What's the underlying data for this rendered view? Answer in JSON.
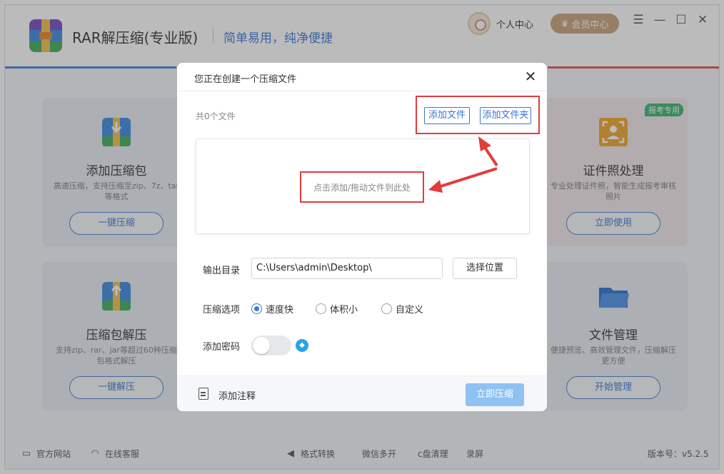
{
  "app": {
    "title": "RAR解压缩(专业版)",
    "slogan": "简单易用，纯净便捷",
    "personal_center": "个人中心",
    "vip_center": "会员中心"
  },
  "cards": [
    {
      "title": "添加压缩包",
      "desc": "高速压缩，支持压缩至zip、7z、tar等格式",
      "button": "一键压缩"
    },
    {
      "title": "证件照处理",
      "desc": "专业处理证件照，智能生成报考审核照片",
      "button": "立即使用",
      "badge": "报考专用"
    },
    {
      "title": "压缩包解压",
      "desc": "支持zip、rar、jar等超过60种压缩包格式解压",
      "button": "一键解压"
    },
    {
      "title": "文件管理",
      "desc": "便捷预览、高效管理文件，压缩解压更方便",
      "button": "开始管理"
    }
  ],
  "footer": {
    "website": "官方网站",
    "service": "在线客服",
    "format": "格式转换",
    "wechat": "微信多开",
    "cclean": "c盘清理",
    "record": "录屏",
    "version": "版本号：v5.2.5"
  },
  "dialog": {
    "title": "您正在创建一个压缩文件",
    "file_count": "共0个文件",
    "add_file": "添加文件",
    "add_folder": "添加文件夹",
    "drop_hint": "点击添加/拖动文件到此处",
    "output_label": "输出目录",
    "output_path": "C:\\Users\\admin\\Desktop\\",
    "choose_location": "选择位置",
    "options_label": "压缩选项",
    "options": [
      "速度快",
      "体积小",
      "自定义"
    ],
    "selected_option": "速度快",
    "password_label": "添加密码",
    "password_enabled": false,
    "add_note": "添加注释",
    "compress_now": "立即压缩"
  },
  "colors": {
    "accent": "#3a78d6",
    "annotation_red": "#e23c3c",
    "compress_button": "#8fc2f2",
    "vip_gold": "#c8a27a",
    "badge_green": "#3ab56d"
  },
  "icons": [
    "avatar-icon",
    "crown-icon",
    "menu-icon",
    "minimize-icon",
    "maximize-icon",
    "close-icon",
    "monitor-icon",
    "headset-icon",
    "megaphone-icon",
    "note-icon",
    "vip-diamond-icon"
  ]
}
